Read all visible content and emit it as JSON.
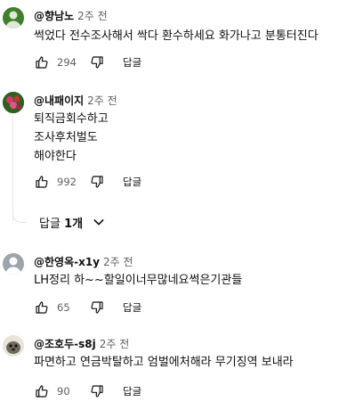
{
  "comments": [
    {
      "author": "@향남노",
      "time": "2주 전",
      "lines": [
        "썩었다 전수조사해서 싹다 환수하세요 화가나고 분통터진다"
      ],
      "likes": "294",
      "reply_label": "답글",
      "avatar_color": "#3f7f2b"
    },
    {
      "author": "@내패이지",
      "time": "2주 전",
      "lines": [
        "퇴직금회수하고",
        "조사후처벌도",
        "해야한다"
      ],
      "likes": "992",
      "reply_label": "답글",
      "avatar_color": "#c0392b",
      "replies_toggle": {
        "prefix": "답글 ",
        "count": "1개"
      }
    },
    {
      "author": "@한영옥-x1y",
      "time": "2주 전",
      "lines": [
        "LH정리 하~~할일이너무많네요썩은기관들"
      ],
      "likes": "65",
      "reply_label": "답글",
      "avatar_color": "#9aa5ad"
    },
    {
      "author": "@조호두-s8j",
      "time": "2주 전",
      "lines": [
        "파면하고 연금박탈하고 엄벌에처해라 무기징역 보내라"
      ],
      "likes": "90",
      "reply_label": "답글",
      "avatar_color": "#6e6a5e"
    }
  ],
  "colors": {
    "text": "#0f0f0f",
    "secondary": "#606060",
    "line": "#e5e5e5"
  }
}
